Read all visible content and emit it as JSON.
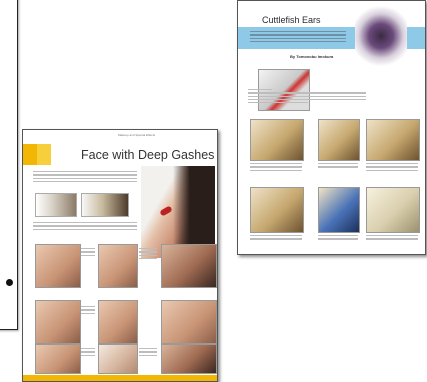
{
  "left_page": {
    "title": "Face with Deep Gashes",
    "header_small": "Makeup and Special Effects"
  },
  "right_page": {
    "title": "Cuttlefish Ears",
    "credit": "By Tomonobu Imokura"
  },
  "colors": {
    "left_accent": "#f2b705",
    "right_accent": "#8fc9e8"
  }
}
